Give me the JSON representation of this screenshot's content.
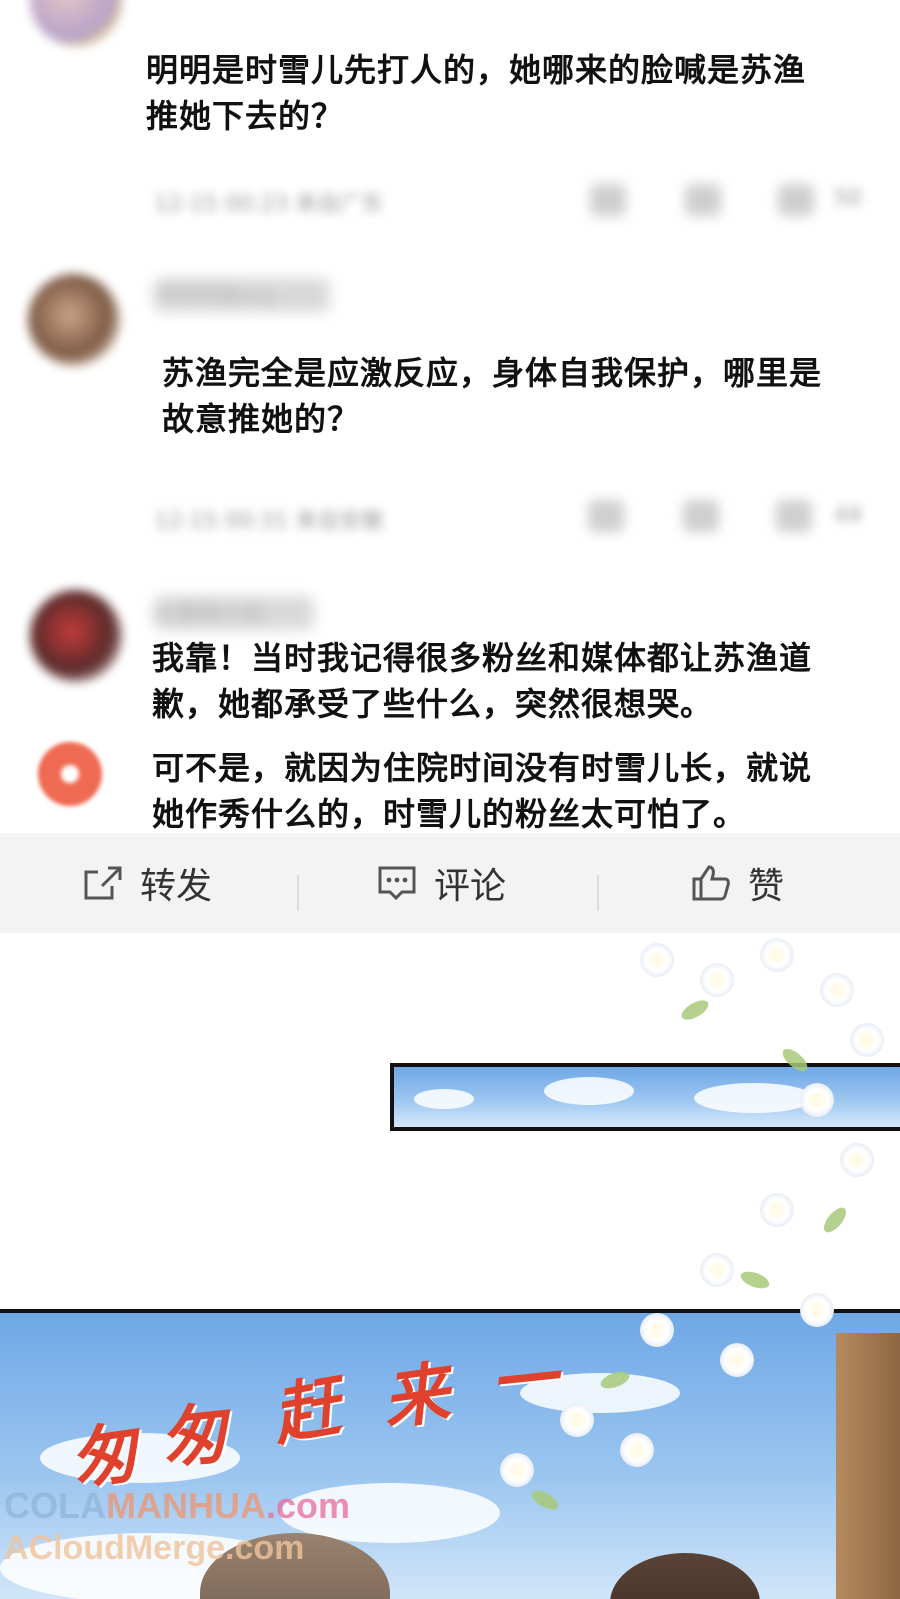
{
  "comments": [
    {
      "text_line1": "明明是时雪儿先打人的，她哪来的脸喊是苏渔",
      "text_line2": "推她下去的？",
      "time": "12-15 00:23 来自广东",
      "likes": "50"
    },
    {
      "username": "咩咩咩鱼my",
      "text_line1": "苏渔完全是应激反应，身体自我保护，哪里是",
      "text_line2": "故意推她的？",
      "time": "12-15 00:31 来自安徽",
      "likes": "44"
    },
    {
      "username": "红薯豫小姐",
      "text_line1": "我靠！当时我记得很多粉丝和媒体都让苏渔道",
      "text_line2": "歉，她都承受了些什么，突然很想哭。"
    },
    {
      "text_line1": "可不是，就因为住院时间没有时雪儿长，就说",
      "text_line2": "她作秀什么的，时雪儿的粉丝太可怕了。"
    }
  ],
  "action_bar": {
    "repost": "转发",
    "comment": "评论",
    "like": "赞"
  },
  "comic": {
    "title_chars": [
      "匆",
      "匆",
      "赶",
      "来",
      "一"
    ]
  },
  "watermark": {
    "line1_a": "COLA",
    "line1_b": "MANHUA",
    "line1_c": ".com",
    "line2": "ACloudMerge.com"
  },
  "colors": {
    "accent_red": "#e0412c",
    "sky_blue": "#6fa8e6",
    "action_bar_bg": "#f3f3f3"
  }
}
